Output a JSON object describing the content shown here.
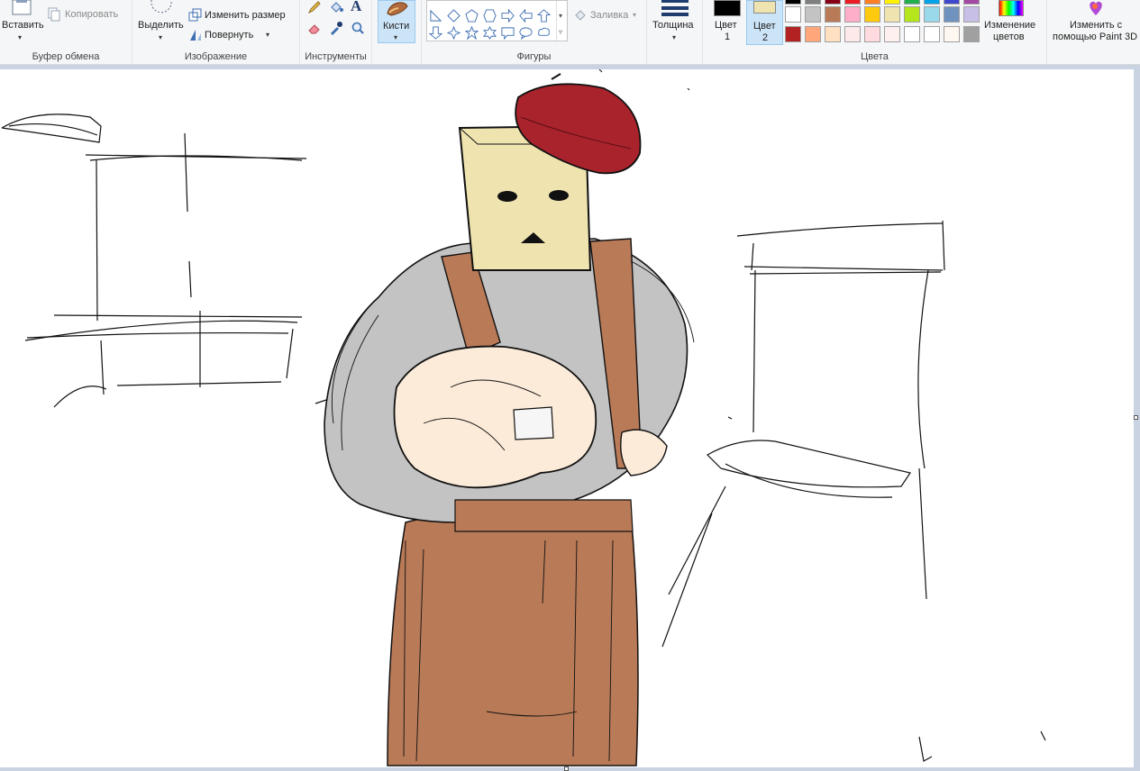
{
  "ribbon": {
    "clipboard": {
      "paste_label": "Вставить",
      "copy_label": "Копировать",
      "group_label": "Буфер обмена"
    },
    "image": {
      "select_label": "Выделить",
      "resize_label": "Изменить размер",
      "rotate_label": "Повернуть",
      "group_label": "Изображение"
    },
    "tools": {
      "group_label": "Инструменты",
      "text_tool_glyph": "A"
    },
    "brushes": {
      "label": "Кисти"
    },
    "shapes": {
      "fill_label": "Заливка",
      "group_label": "Фигуры"
    },
    "size": {
      "label": "Толщина"
    },
    "colors": {
      "color1_label": "Цвет",
      "color1_num": "1",
      "color2_label": "Цвет",
      "color2_num": "2",
      "color1_value": "#000000",
      "color2_value": "#efe4b0",
      "group_label": "Цвета",
      "edit_label_1": "Изменение",
      "edit_label_2": "цветов",
      "paint3d_label_1": "Изменить с",
      "paint3d_label_2": "помощью Paint 3D",
      "palette_row1": [
        "#000000",
        "#7f7f7f",
        "#880015",
        "#ed1c24",
        "#ff7f27",
        "#fff200",
        "#22b14c",
        "#00a2e8",
        "#3f48cc",
        "#a349a4"
      ],
      "palette_row2": [
        "#ffffff",
        "#c3c3c3",
        "#b97a57",
        "#ffaec9",
        "#ffc90e",
        "#efe4b0",
        "#b5e61d",
        "#99d9ea",
        "#7092be",
        "#c8bfe7"
      ],
      "palette_row3": [
        "#b22222",
        "#ffa77a",
        "#ffe0c0",
        "#fde9e9",
        "#ffdbe0",
        "#fff0f0",
        "#ffffff",
        "#ffffff",
        "#fff8f0",
        "#a0a0a0"
      ]
    }
  },
  "canvas": {
    "drawing_colors": {
      "beret": "#a8232b",
      "box_head": "#efe4b0",
      "apron": "#b97a57",
      "shirt": "#c3c3c3",
      "hands": "#fcebd9"
    }
  }
}
